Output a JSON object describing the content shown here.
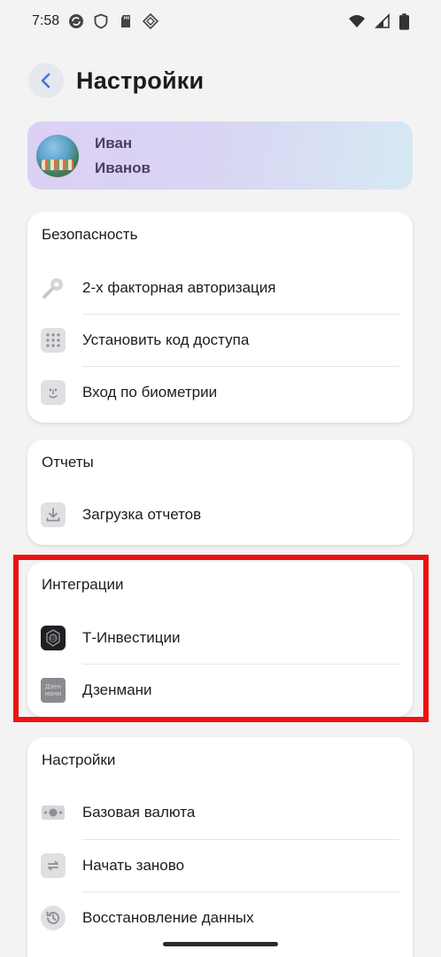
{
  "status_bar": {
    "time": "7:58",
    "left_icons": [
      "sync-icon",
      "shield-icon",
      "sd-card-icon",
      "diamond-icon"
    ],
    "right_icons": [
      "wifi-icon",
      "signal-icon",
      "battery-icon"
    ]
  },
  "header": {
    "back_icon": "chevron-left-icon",
    "title": "Настройки"
  },
  "profile": {
    "first_name": "Иван",
    "last_name": "Иванов"
  },
  "security": {
    "title": "Безопасность",
    "items": [
      {
        "label": "2-х факторная авторизация",
        "icon": "key-icon"
      },
      {
        "label": "Установить код доступа",
        "icon": "keypad-icon"
      },
      {
        "label": "Вход по биометрии",
        "icon": "face-id-icon"
      }
    ]
  },
  "reports": {
    "title": "Отчеты",
    "items": [
      {
        "label": "Загрузка отчетов",
        "icon": "download-icon"
      }
    ]
  },
  "integrations": {
    "title": "Интеграции",
    "items": [
      {
        "label": "Т-Инвестиции",
        "icon": "t-invest-logo-icon"
      },
      {
        "label": "Дзенмани",
        "icon": "zenmoney-logo-icon",
        "logo_text": "Дзен мани"
      }
    ]
  },
  "settings": {
    "title": "Настройки",
    "items": [
      {
        "label": "Базовая валюта",
        "icon": "banknote-icon"
      },
      {
        "label": "Начать заново",
        "icon": "refresh-icon"
      },
      {
        "label": "Восстановление данных",
        "icon": "history-icon"
      }
    ]
  },
  "colors": {
    "background": "#f3f3f4",
    "card": "#ffffff",
    "icon_gray": "#dcdcdf",
    "highlight": "#ee1111",
    "back_button_bg": "#e6e8ee",
    "back_arrow": "#3b78e7"
  }
}
